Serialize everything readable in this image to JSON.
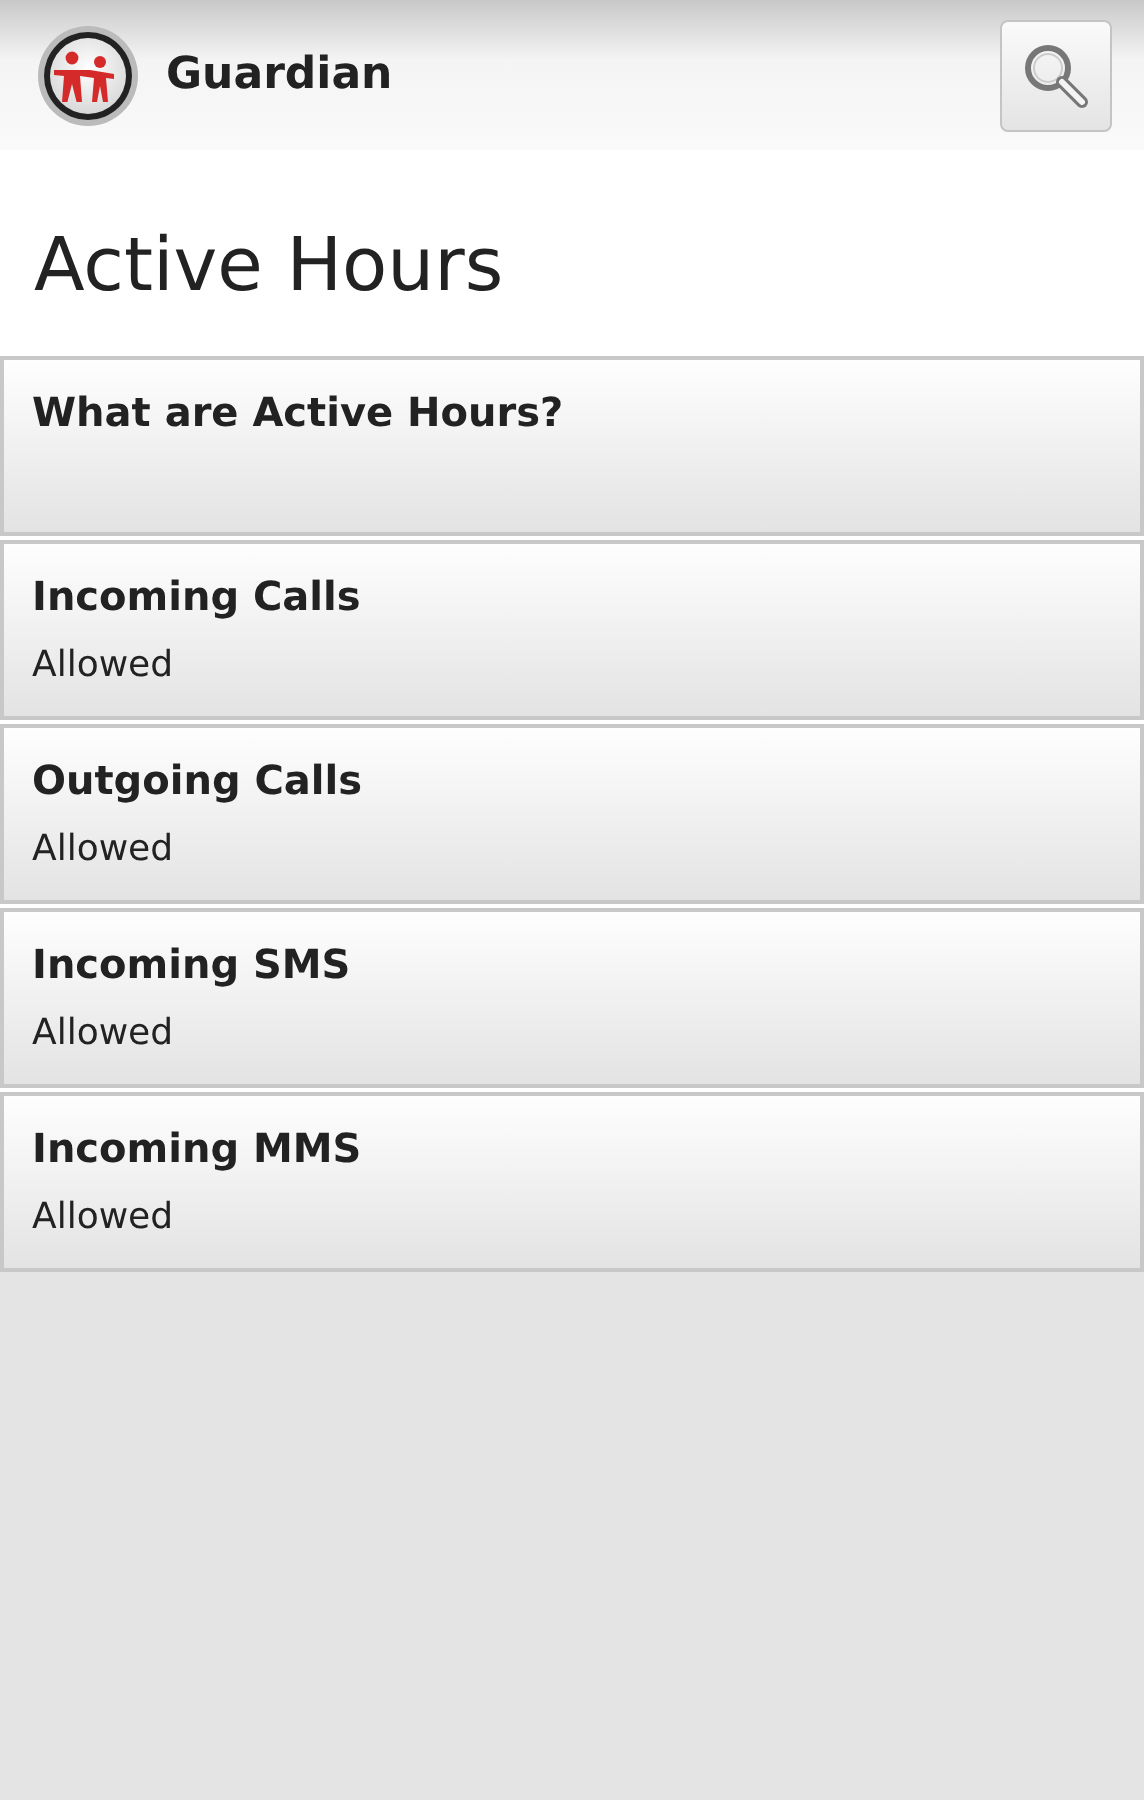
{
  "app_bar": {
    "title": "Guardian"
  },
  "page_title": "Active Hours",
  "items": [
    {
      "title": "What are Active Hours?"
    },
    {
      "title": "Incoming Calls",
      "status": "Allowed"
    },
    {
      "title": "Outgoing Calls",
      "status": "Allowed"
    },
    {
      "title": "Incoming SMS",
      "status": "Allowed"
    },
    {
      "title": "Incoming MMS",
      "status": "Allowed"
    }
  ]
}
